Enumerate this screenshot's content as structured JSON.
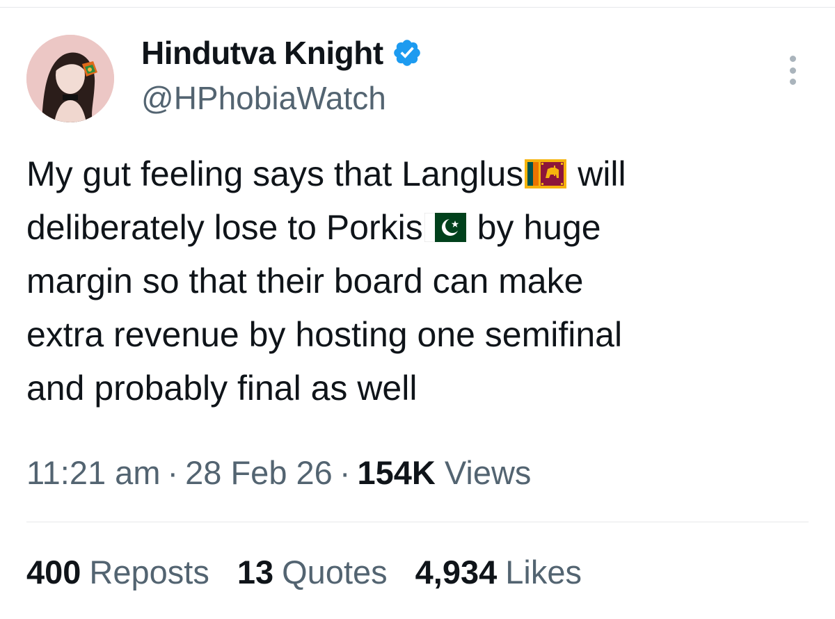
{
  "author": {
    "display_name": "Hindutva Knight",
    "handle": "@HPhobiaWatch",
    "verified_icon": "verified-badge-icon"
  },
  "tweet": {
    "line1_a": "My gut feeling says that Langlus",
    "line1_b": " will",
    "line2_a": "deliberately lose to Porkis",
    "line2_b": " by huge",
    "line3": "margin so that their board can make",
    "line4": "extra revenue by hosting one semifinal",
    "line5": "and probably final as well",
    "flags": [
      "sri-lanka-flag-icon",
      "pakistan-flag-icon"
    ]
  },
  "meta": {
    "time": "11:21 am",
    "date": "28 Feb 26",
    "views_count": "154K",
    "views_label": "Views",
    "separator": "·"
  },
  "stats": {
    "reposts_count": "400",
    "reposts_label": "Reposts",
    "quotes_count": "13",
    "quotes_label": "Quotes",
    "likes_count": "4,934",
    "likes_label": "Likes"
  },
  "colors": {
    "text": "#0f1419",
    "secondary": "#536471",
    "verified": "#1d9bf0",
    "divider": "#e6e8ea"
  }
}
